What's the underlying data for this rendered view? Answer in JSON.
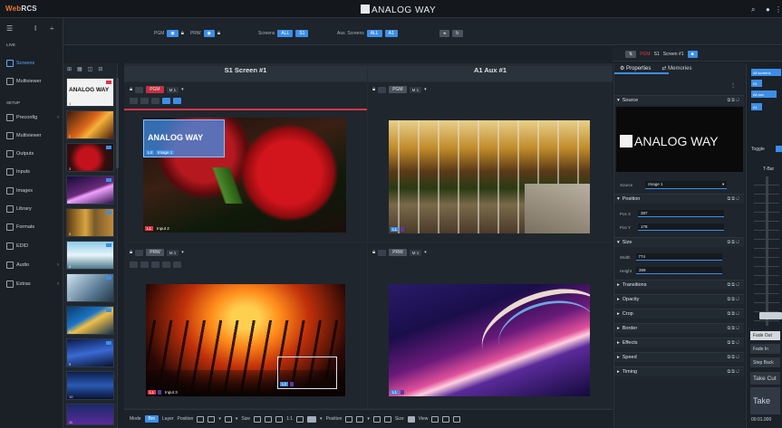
{
  "app": {
    "name_prefix": "Web",
    "name_suffix": "RCS",
    "brand": "ANALOG WAY"
  },
  "sidebar": {
    "section_live": "LIVE",
    "section_setup": "SETUP",
    "live_items": [
      {
        "label": "Screens"
      },
      {
        "label": "Multiviewer"
      }
    ],
    "setup_items": [
      {
        "label": "Preconfig"
      },
      {
        "label": "Multiviewer"
      },
      {
        "label": "Outputs"
      },
      {
        "label": "Inputs"
      },
      {
        "label": "Images"
      },
      {
        "label": "Library"
      },
      {
        "label": "Formats"
      },
      {
        "label": "EDID"
      },
      {
        "label": "Audio"
      },
      {
        "label": "Extras"
      }
    ]
  },
  "toolbar": {
    "pgm": "PGM",
    "prw": "PRW",
    "screens": "Screens",
    "aux_screens": "Aux. Screens",
    "all": "ALL",
    "s1": "S1",
    "a1": "A1"
  },
  "thumbs": {
    "numbers": [
      "1",
      "2",
      "3",
      "4",
      "5",
      "6",
      "7",
      "8",
      "9",
      "10",
      "11",
      "12"
    ]
  },
  "screens": {
    "s1_title": "S1 Screen #1",
    "a1_title": "A1 Aux #1",
    "pgm": "PGM",
    "prw": "PRW",
    "m1": "M 1",
    "overlay_brand": "ANALOG WAY",
    "image_label": "Image 1",
    "input2": "Input 2",
    "input3": "Input 3",
    "l1": "L1",
    "l2": "L2",
    "l3": "L3",
    "l4": "L4"
  },
  "bottombar": {
    "mode": "Mode",
    "bm": "Bm",
    "layer": "Layer",
    "position": "Position",
    "size": "Size",
    "ratio": "1:1",
    "position2": "Position",
    "size2": "Size",
    "view": "View"
  },
  "properties": {
    "tab_properties": "Properties",
    "tab_memories": "Memories",
    "pgm": "PGM",
    "s1": "S1",
    "screen": "Screen #1",
    "source_section": "Source",
    "source_label": "Source",
    "source_value": "Image 1",
    "position_section": "Position",
    "pos_x_label": "Pos X",
    "pos_x": "387",
    "pos_y_label": "Pos Y",
    "pos_y": "178",
    "size_section": "Size",
    "width_label": "Width",
    "width": "774",
    "height_label": "Height",
    "height": "359",
    "collapsed": [
      "Transitions",
      "Opacity",
      "Crop",
      "Border",
      "Effects",
      "Speed",
      "Timing"
    ]
  },
  "rightpanel": {
    "all_screens": "All screens",
    "s1": "S1",
    "all_aux": "All aux",
    "a1": "A1",
    "toggle": "Toggle",
    "tbar": "T-Bar",
    "fade_out": "Fade Out",
    "fade_in": "Fade In",
    "step_back": "Step Back",
    "take_cut": "Take Cut",
    "take": "Take",
    "time": "00:01.000"
  },
  "colors": {
    "accent": "#3d8ee8",
    "red": "#e2344a",
    "bg": "#1b2128"
  }
}
